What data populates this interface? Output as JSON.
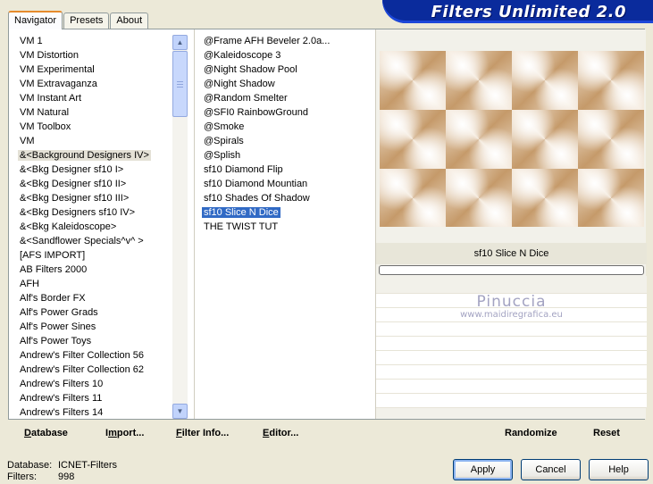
{
  "tabs": [
    {
      "label": "Navigator",
      "active": true
    },
    {
      "label": "Presets",
      "active": false
    },
    {
      "label": "About",
      "active": false
    }
  ],
  "header": {
    "title": "Filters Unlimited 2.0",
    "color": "#0a2b9c"
  },
  "categories": [
    "VM 1",
    "VM Distortion",
    "VM Experimental",
    "VM Extravaganza",
    "VM Instant Art",
    "VM Natural",
    "VM Toolbox",
    "VM",
    "&<Background Designers IV>",
    "&<Bkg Designer sf10 I>",
    "&<Bkg Designer sf10 II>",
    "&<Bkg Designer sf10 III>",
    "&<Bkg Designers sf10 IV>",
    "&<Bkg Kaleidoscope>",
    "&<Sandflower Specials^v^ >",
    "[AFS IMPORT]",
    "AB Filters 2000",
    "AFH",
    "Alf's Border FX",
    "Alf's Power Grads",
    "Alf's Power Sines",
    "Alf's Power Toys",
    "Andrew's Filter Collection 56",
    "Andrew's Filter Collection 62",
    "Andrew's Filters 10",
    "Andrew's Filters 11",
    "Andrew's Filters 14"
  ],
  "selected_category": "&<Background Designers IV>",
  "filters": [
    "@Frame AFH Beveler 2.0a...",
    "@Kaleidoscope 3",
    "@Night Shadow Pool",
    "@Night Shadow",
    "@Random Smelter",
    "@SFI0 RainbowGround",
    "@Smoke",
    "@Spirals",
    "@Splish",
    "sf10 Diamond Flip",
    "sf10 Diamond Mountian",
    "sf10 Shades Of Shadow",
    "sf10 Slice N Dice",
    "THE TWIST TUT"
  ],
  "selected_filter": "sf10 Slice N Dice",
  "preview": {
    "filter_name": "sf10 Slice N Dice",
    "progress": 0
  },
  "watermark": {
    "name": "Pinuccia",
    "url": "www.maidiregrafica.eu"
  },
  "bottom_bar": {
    "database": {
      "label_u": "D",
      "label_rest": "atabase"
    },
    "import": {
      "label_pre": "I",
      "label_u": "m",
      "label_rest": "port..."
    },
    "filter_info": {
      "label_u": "F",
      "label_rest": "ilter Info..."
    },
    "editor": {
      "label_u": "E",
      "label_rest": "ditor..."
    },
    "randomize": "Randomize",
    "reset": "Reset"
  },
  "status": {
    "database_label": "Database:",
    "database_value": "ICNET-Filters",
    "filters_label": "Filters:",
    "filters_value": "998"
  },
  "buttons": {
    "apply": "Apply",
    "cancel": "Cancel",
    "help": "Help"
  },
  "colors": {
    "selection": "#316ac5",
    "tab_accent": "#e68b2c",
    "background": "#ece9d8"
  }
}
